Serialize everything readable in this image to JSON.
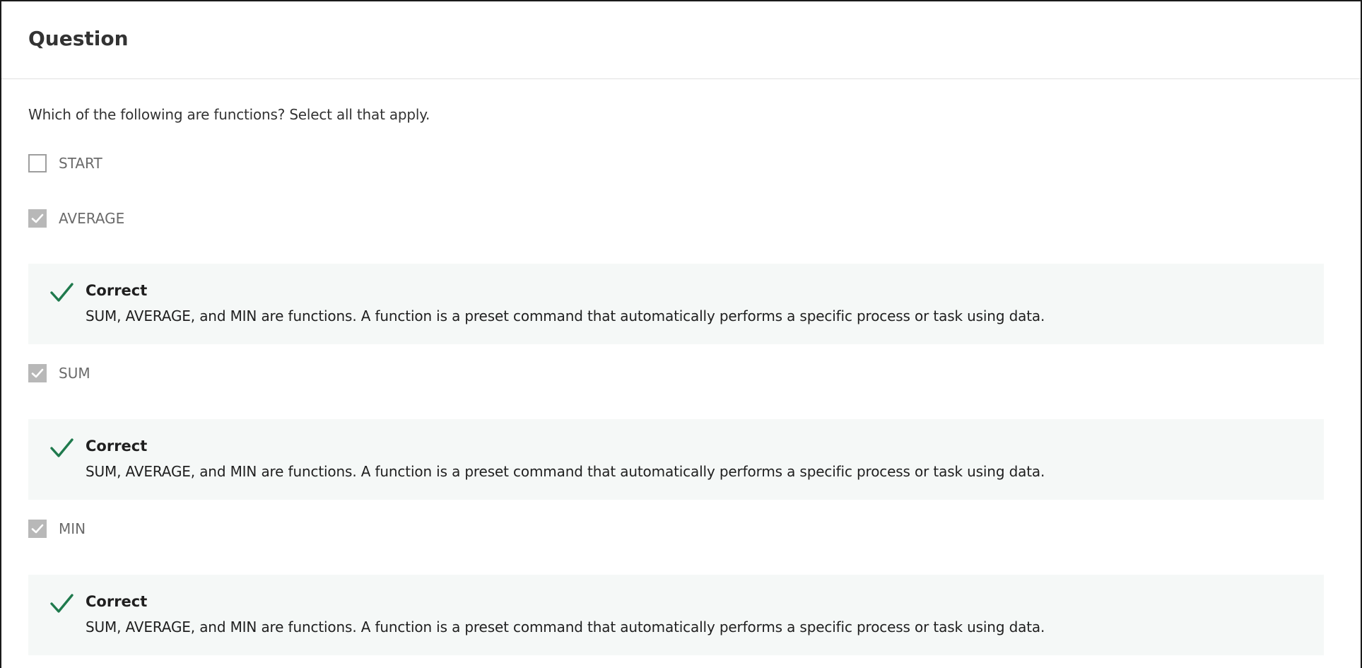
{
  "header": {
    "title": "Question"
  },
  "question": {
    "prompt": "Which of the following are functions? Select all that apply."
  },
  "options": [
    {
      "label": "START",
      "checked": false
    },
    {
      "label": "AVERAGE",
      "checked": true
    },
    {
      "label": "SUM",
      "checked": true
    },
    {
      "label": "MIN",
      "checked": true
    }
  ],
  "feedback": [
    {
      "title": "Correct",
      "text": "SUM, AVERAGE, and MIN are functions. A function is a preset command that automatically performs a specific process or task using data."
    },
    {
      "title": "Correct",
      "text": "SUM, AVERAGE, and MIN are functions. A function is a preset command that automatically performs a specific process or task using data."
    },
    {
      "title": "Correct",
      "text": "SUM, AVERAGE, and MIN are functions. A function is a preset command that automatically performs a specific process or task using data."
    }
  ],
  "colors": {
    "correct": "#1f7a4d",
    "feedback_bg": "#f5f8f7",
    "checkbox_checked": "#b8b8b8"
  },
  "icons": {
    "check": "check-icon",
    "correct": "correct-checkmark-icon"
  }
}
